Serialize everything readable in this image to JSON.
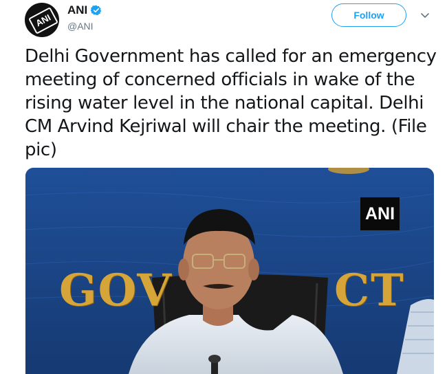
{
  "tweet": {
    "author": {
      "display_name": "ANI",
      "handle": "@ANI",
      "verified": true,
      "avatar_logo_text": "ANI"
    },
    "follow_label": "Follow",
    "menu_icon": "chevron-down-icon",
    "text": "Delhi Government has called for an emergency meeting of concerned officials in wake of the rising water level in the national capital. Delhi CM Arvind Kejriwal will chair the meeting. (File pic)",
    "media": {
      "watermark": "ANI",
      "banner_left": "GOV",
      "banner_right": "CT"
    }
  },
  "colors": {
    "accent": "#1da1f2",
    "text_primary": "#14171a",
    "text_secondary": "#657786",
    "photo_backdrop": "#1d4a8f",
    "banner_gold": "#d6a53a"
  }
}
